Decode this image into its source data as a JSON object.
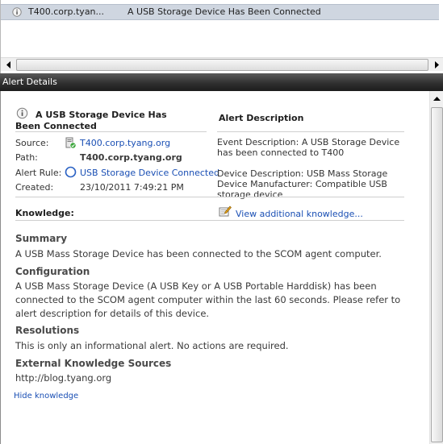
{
  "alert_list": {
    "rows": [
      {
        "source": "T400.corp.tyan...",
        "name": "A USB Storage Device Has Been Connected",
        "icon": "info-icon"
      }
    ]
  },
  "details_pane": {
    "title": "Alert Details"
  },
  "alert": {
    "title": "A USB Storage Device Has Been Connected",
    "labels": {
      "source": "Source:",
      "path": "Path:",
      "rule": "Alert Rule:",
      "created": "Created:"
    },
    "source": "T400.corp.tyang.org",
    "path": "T400.corp.tyang.org",
    "rule": "USB Storage Device Connected",
    "created": "23/10/2011 7:49:21 PM"
  },
  "alert_description": {
    "heading": "Alert Description",
    "event_description": "Event Description: A USB Storage Device has been connected to T400",
    "device_description": "Device Description: USB Mass Storage Device Manufacturer: Compatible USB storage device"
  },
  "knowledge": {
    "label": "Knowledge:",
    "view_link": "View additional knowledge...",
    "hide_link": "Hide knowledge",
    "sections": {
      "summary": {
        "heading": "Summary",
        "text": "A USB Mass Storage Device has been connected to the SCOM agent computer."
      },
      "configuration": {
        "heading": "Configuration",
        "text": "A USB Mass Storage Device (A USB Key or A USB Portable Harddisk) has been connected to the SCOM agent computer within the last 60 seconds. Please refer to alert description for details of this device."
      },
      "resolutions": {
        "heading": "Resolutions",
        "text": "This is only an informational alert. No actions are required."
      },
      "external": {
        "heading": "External Knowledge Sources",
        "text": "http://blog.tyang.org"
      }
    }
  },
  "colors": {
    "link": "#1a4fb4",
    "header_bg": "#303030",
    "selected_row": "#cfd6e0"
  }
}
